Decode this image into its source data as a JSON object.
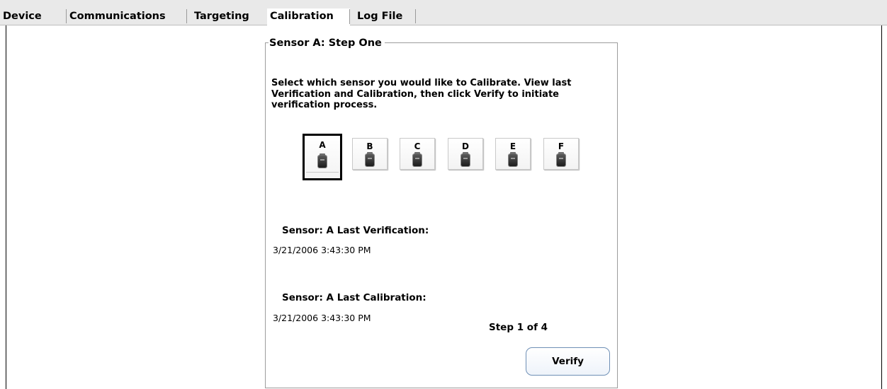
{
  "tabs": [
    {
      "label": "Device",
      "active": false
    },
    {
      "label": "Communications",
      "active": false
    },
    {
      "label": "Targeting",
      "active": false
    },
    {
      "label": "Calibration",
      "active": true
    },
    {
      "label": "Log File",
      "active": false
    }
  ],
  "panel": {
    "title": "Sensor A: Step One",
    "instructions": "Select which sensor you would like to Calibrate.  View last Verification and Calibration, then click Verify to initiate verification process.",
    "sensors": [
      {
        "label": "A",
        "selected": true,
        "icon": "sensor-device-icon"
      },
      {
        "label": "B",
        "selected": false,
        "icon": "sensor-device-icon"
      },
      {
        "label": "C",
        "selected": false,
        "icon": "sensor-device-icon"
      },
      {
        "label": "D",
        "selected": false,
        "icon": "sensor-device-icon"
      },
      {
        "label": "E",
        "selected": false,
        "icon": "sensor-device-icon"
      },
      {
        "label": "F",
        "selected": false,
        "icon": "sensor-device-icon"
      }
    ],
    "last_verification_label": "Sensor:  A  Last Verification:",
    "last_verification_value": "3/21/2006 3:43:30 PM",
    "last_calibration_label": "Sensor:  A  Last Calibration:",
    "last_calibration_value": "3/21/2006 3:43:30 PM",
    "step_text": "Step 1 of 4",
    "verify_label": "Verify"
  },
  "colors": {
    "tabbar_bg": "#e9e9e9",
    "verify_border": "#6f90b6",
    "selected_border": "#000000"
  }
}
